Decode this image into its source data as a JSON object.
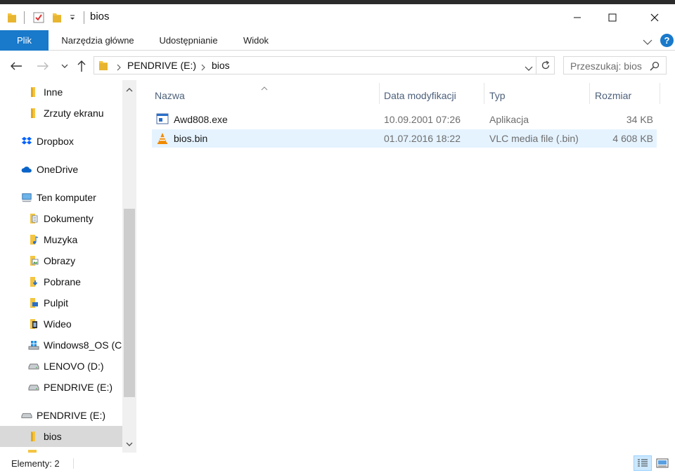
{
  "window": {
    "title": "bios",
    "controls": [
      "minimize-icon",
      "maximize-icon",
      "close-icon"
    ]
  },
  "ribbon": {
    "tabs": [
      "Plik",
      "Narzędzia główne",
      "Udostępnianie",
      "Widok"
    ]
  },
  "address": {
    "crumbs": [
      "PENDRIVE (E:)",
      "bios"
    ]
  },
  "search": {
    "placeholder": "Przeszukaj: bios"
  },
  "nav": {
    "items": [
      {
        "label": "Inne",
        "icon": "folder-icon"
      },
      {
        "label": "Zrzuty ekranu",
        "icon": "folder-icon"
      },
      {
        "label": "Dropbox",
        "icon": "dropbox-icon"
      },
      {
        "label": "OneDrive",
        "icon": "cloud-icon"
      },
      {
        "label": "Ten komputer",
        "icon": "computer-icon"
      },
      {
        "label": "Dokumenty",
        "icon": "documents-folder-icon"
      },
      {
        "label": "Muzyka",
        "icon": "music-folder-icon"
      },
      {
        "label": "Obrazy",
        "icon": "pictures-folder-icon"
      },
      {
        "label": "Pobrane",
        "icon": "downloads-folder-icon"
      },
      {
        "label": "Pulpit",
        "icon": "desktop-folder-icon"
      },
      {
        "label": "Wideo",
        "icon": "video-folder-icon"
      },
      {
        "label": "Windows8_OS (C",
        "icon": "windows-drive-icon"
      },
      {
        "label": "LENOVO (D:)",
        "icon": "drive-icon"
      },
      {
        "label": "PENDRIVE (E:)",
        "icon": "drive-icon"
      },
      {
        "label": "PENDRIVE (E:)",
        "icon": "usb-drive-icon"
      },
      {
        "label": "bios",
        "icon": "folder-icon"
      }
    ]
  },
  "columns": {
    "name": "Nazwa",
    "date": "Data modyfikacji",
    "type": "Typ",
    "size": "Rozmiar"
  },
  "files": [
    {
      "name": "Awd808.exe",
      "date": "10.09.2001 07:26",
      "type": "Aplikacja",
      "size": "34 KB",
      "icon": "exe-icon"
    },
    {
      "name": "bios.bin",
      "date": "01.07.2016 18:22",
      "type": "VLC media file (.bin)",
      "size": "4 608 KB",
      "icon": "vlc-icon"
    }
  ],
  "status": {
    "text": "Elementy: 2"
  },
  "colors": {
    "accent": "#1979ca",
    "selection": "#e5f3ff",
    "nav_selected": "#d9d9d9"
  }
}
